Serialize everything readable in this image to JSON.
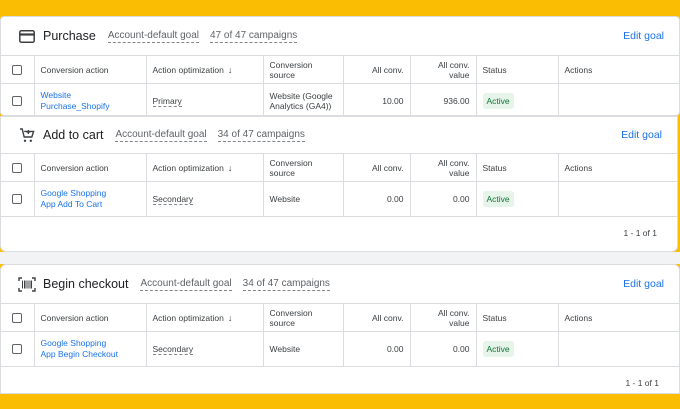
{
  "columns": {
    "conversion_action": "Conversion action",
    "action_optimization": "Action optimization",
    "conversion_source": "Conversion source",
    "all_conv": "All conv.",
    "all_conv_value": "All conv. value",
    "status": "Status",
    "actions": "Actions"
  },
  "edit_goal_label": "Edit goal",
  "goals": [
    {
      "title": "Purchase",
      "icon": "credit-card-icon",
      "goal_type": "Account-default goal",
      "campaigns": "47 of 47 campaigns",
      "rows": [
        {
          "name_line1": "Website",
          "name_line2": "Purchase_Shopify",
          "optimization": "Primary",
          "source": "Website (Google Analytics (GA4))",
          "all_conv": "10.00",
          "all_conv_value": "936.00",
          "status": "Active"
        }
      ]
    },
    {
      "title": "Add to cart",
      "icon": "cart-icon",
      "goal_type": "Account-default goal",
      "campaigns": "34 of 47 campaigns",
      "pagination": "1 - 1 of 1",
      "rows": [
        {
          "name_line1": "Google Shopping",
          "name_line2": "App Add To Cart",
          "optimization": "Secondary",
          "source": "Website",
          "all_conv": "0.00",
          "all_conv_value": "0.00",
          "status": "Active"
        }
      ]
    },
    {
      "title": "Begin checkout",
      "icon": "barcode-icon",
      "goal_type": "Account-default goal",
      "campaigns": "34 of 47 campaigns",
      "pagination": "1 - 1 of 1",
      "rows": [
        {
          "name_line1": "Google Shopping",
          "name_line2": "App Begin Checkout",
          "optimization": "Secondary",
          "source": "Website",
          "all_conv": "0.00",
          "all_conv_value": "0.00",
          "status": "Active"
        }
      ]
    }
  ]
}
